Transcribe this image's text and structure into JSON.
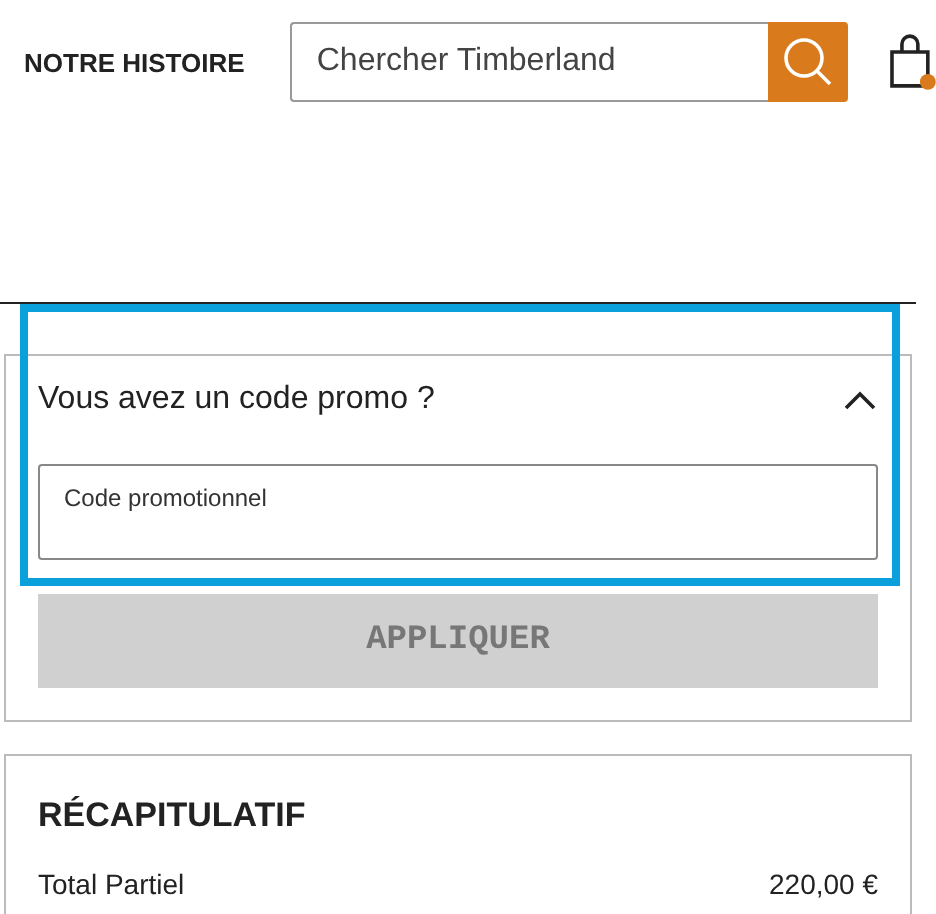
{
  "header": {
    "nav_link": "NOTRE HISTOIRE",
    "search": {
      "placeholder": "Chercher Timberland"
    }
  },
  "promo": {
    "title": "Vous avez un code promo ?",
    "expanded": true,
    "field": {
      "placeholder": "Code promotionnel"
    },
    "apply_button": {
      "label": "APPLIQUER",
      "disabled": true
    },
    "highlighted": true
  },
  "summary": {
    "title": "RÉCAPITULATIF",
    "rows": [
      {
        "label": "Total Partiel",
        "value": "220,00 €"
      }
    ]
  }
}
